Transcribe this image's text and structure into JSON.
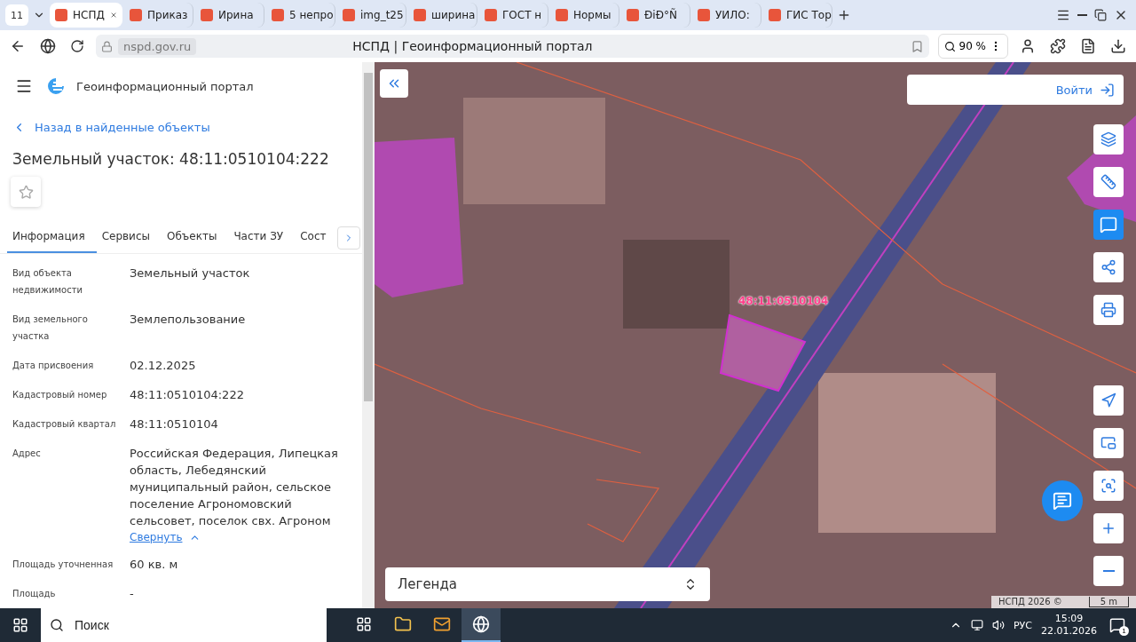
{
  "browser": {
    "tab_count": "11",
    "tabs": [
      {
        "title": "НСПД",
        "selected": true
      },
      {
        "title": "Приказ",
        "selected": false
      },
      {
        "title": "Ирина",
        "selected": false
      },
      {
        "title": "5 непро",
        "selected": false
      },
      {
        "title": "img_t25",
        "selected": false
      },
      {
        "title": "ширина",
        "selected": false
      },
      {
        "title": "ГОСТ н",
        "selected": false
      },
      {
        "title": "Нормы",
        "selected": false
      },
      {
        "title": "ĐiĐ°Ñ",
        "selected": false
      },
      {
        "title": "УИЛО:",
        "selected": false
      },
      {
        "title": "ГИС Тор",
        "selected": false
      }
    ],
    "url": "nspd.gov.ru",
    "page_title": "НСПД | Геоинформационный портал",
    "zoom": "90 %"
  },
  "sidebar": {
    "portal_title": "Геоинформационный портал",
    "back_link": "Назад в найденные объекты",
    "heading": "Земельный участок: 48:11:0510104:222",
    "tabs": [
      {
        "label": "Информация",
        "selected": true
      },
      {
        "label": "Сервисы",
        "selected": false
      },
      {
        "label": "Объекты",
        "selected": false
      },
      {
        "label": "Части ЗУ",
        "selected": false
      },
      {
        "label": "Сост",
        "selected": false
      }
    ],
    "rows": [
      {
        "label": "Вид объекта недвижимости",
        "value": "Земельный участок"
      },
      {
        "label": "Вид земельного участка",
        "value": "Землепользование"
      },
      {
        "label": "Дата присвоения",
        "value": "02.12.2025"
      },
      {
        "label": "Кадастровый номер",
        "value": "48:11:0510104:222"
      },
      {
        "label": "Кадастровый квартал",
        "value": "48:11:0510104"
      },
      {
        "label": "Адрес",
        "value": "Российская Федерация, Липецкая область, Лебедянский муниципальный район, сельское поселение Агрономовский сельсовет, поселок свх. Агроном",
        "link": "Свернуть"
      },
      {
        "label": "Площадь уточненная",
        "value": "60 кв. м"
      },
      {
        "label": "Площадь",
        "value": "-"
      }
    ]
  },
  "map": {
    "login": "Войти",
    "parcel_label": "48:11:0510104",
    "legend": "Легенда",
    "attribution": "НСПД 2026 ©",
    "scale": "5 m"
  },
  "taskbar": {
    "search_placeholder": "Поиск",
    "apps": [
      {
        "kind": "taskview",
        "selected": false
      },
      {
        "kind": "folder",
        "selected": false
      },
      {
        "kind": "mail",
        "selected": false
      },
      {
        "kind": "browser",
        "selected": true
      }
    ],
    "language": "РУС",
    "time": "15:09",
    "date": "22.01.2026",
    "notifications": "1"
  }
}
